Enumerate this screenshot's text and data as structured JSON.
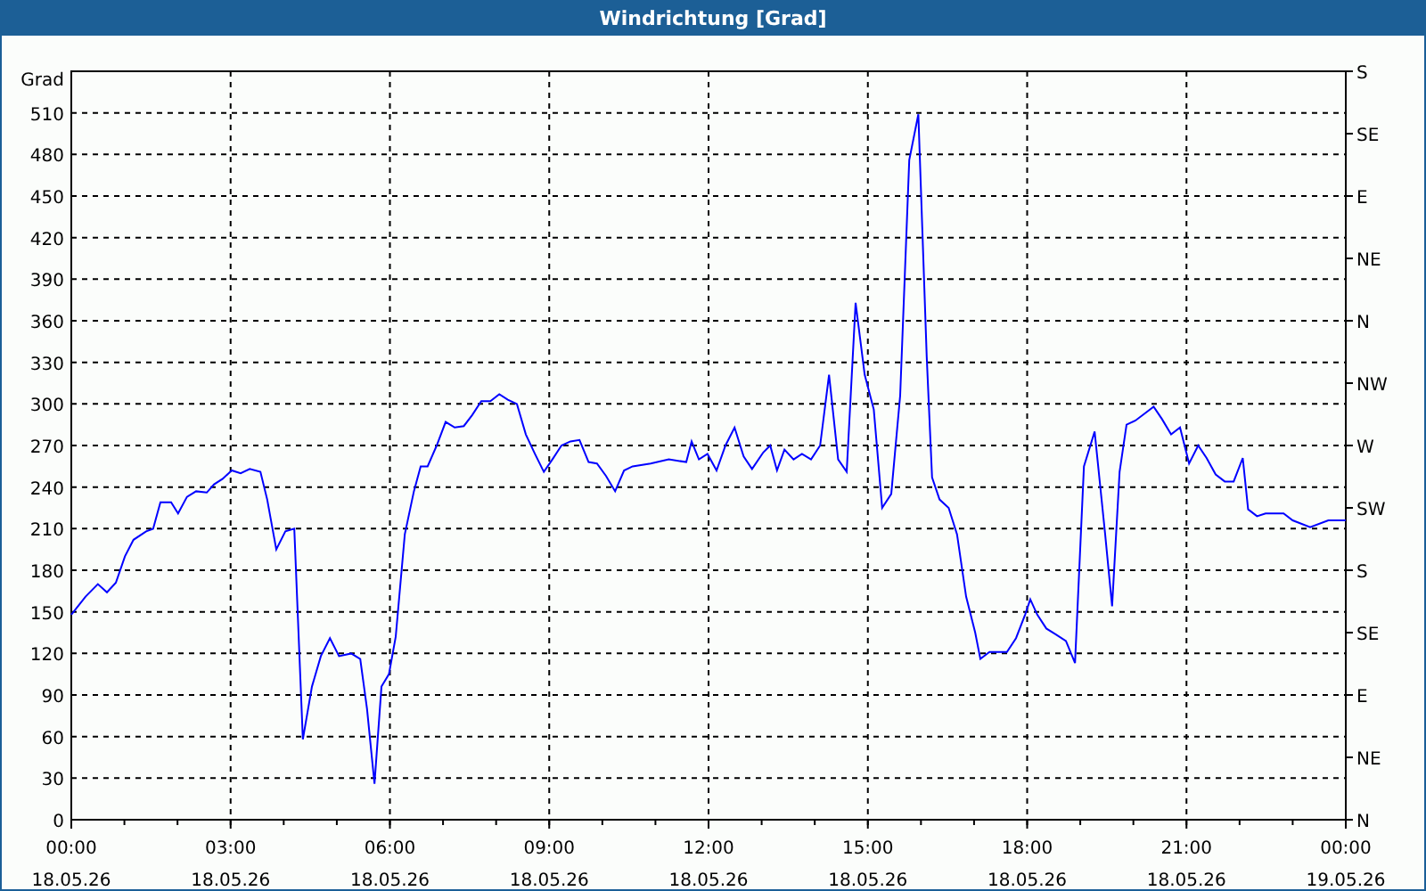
{
  "window": {
    "title": "Windrichtung [Grad]"
  },
  "chart": {
    "date_labels": [
      "18.05.26",
      "18.05.26",
      "18.05.26",
      "18.05.26",
      "18.05.26",
      "18.05.26",
      "18.05.26",
      "18.05.26",
      "19.05.26"
    ],
    "direction_labels": [
      "S",
      "SE",
      "E",
      "NE",
      "N",
      "NW",
      "W",
      "SW",
      "S",
      "SE",
      "E",
      "NE",
      "N"
    ],
    "chart_data": {
      "type": "line",
      "grid": true,
      "ylabel": "Grad",
      "ylim": [
        0,
        540
      ],
      "yticks": [
        0,
        30,
        60,
        90,
        120,
        150,
        180,
        210,
        240,
        270,
        300,
        330,
        360,
        390,
        420,
        450,
        480,
        510
      ],
      "xlim": [
        0,
        24
      ],
      "xticks": [
        {
          "value": 0,
          "label": "00:00"
        },
        {
          "value": 3,
          "label": "03:00"
        },
        {
          "value": 6,
          "label": "06:00"
        },
        {
          "value": 9,
          "label": "09:00"
        },
        {
          "value": 12,
          "label": "12:00"
        },
        {
          "value": 15,
          "label": "15:00"
        },
        {
          "value": 18,
          "label": "18:00"
        },
        {
          "value": 21,
          "label": "21:00"
        },
        {
          "value": 24,
          "label": "00:00"
        }
      ],
      "x": [
        0,
        0.27,
        0.5,
        0.67,
        0.84,
        1.01,
        1.17,
        1.41,
        1.54,
        1.68,
        1.88,
        2.01,
        2.18,
        2.35,
        2.55,
        2.69,
        2.85,
        3.02,
        3.19,
        3.36,
        3.56,
        3.69,
        3.86,
        4.03,
        4.2,
        4.36,
        4.53,
        4.7,
        4.87,
        5.04,
        5.27,
        5.44,
        5.57,
        5.71,
        5.84,
        5.98,
        6.11,
        6.28,
        6.45,
        6.58,
        6.71,
        6.88,
        7.05,
        7.22,
        7.39,
        7.55,
        7.72,
        7.89,
        8.06,
        8.22,
        8.39,
        8.56,
        8.73,
        8.9,
        9.06,
        9.23,
        9.4,
        9.57,
        9.74,
        9.9,
        10.07,
        10.24,
        10.41,
        10.57,
        10.91,
        11.25,
        11.58,
        11.68,
        11.82,
        11.98,
        12.15,
        12.32,
        12.49,
        12.66,
        12.82,
        13.03,
        13.16,
        13.29,
        13.43,
        13.6,
        13.76,
        13.93,
        14.1,
        14.27,
        14.44,
        14.6,
        14.77,
        14.94,
        15.11,
        15.27,
        15.44,
        15.61,
        15.78,
        15.95,
        16.11,
        16.21,
        16.35,
        16.52,
        16.68,
        16.85,
        17.02,
        17.12,
        17.29,
        17.46,
        17.62,
        17.79,
        17.96,
        18.06,
        18.19,
        18.36,
        18.53,
        18.73,
        18.9,
        19.07,
        19.27,
        19.47,
        19.6,
        19.74,
        19.87,
        20.04,
        20.21,
        20.38,
        20.54,
        20.71,
        20.88,
        21.05,
        21.22,
        21.38,
        21.55,
        21.72,
        21.89,
        22.06,
        22.16,
        22.33,
        22.49,
        22.83,
        23,
        23.33,
        23.67,
        24
      ],
      "series": [
        {
          "color": "#0000ff",
          "values": [
            148,
            161,
            170,
            164,
            171,
            190,
            202,
            208,
            210,
            229,
            229,
            221,
            233,
            237,
            236,
            242,
            246,
            252,
            250,
            253,
            251,
            231,
            195,
            208,
            210,
            58,
            96,
            118,
            131,
            118,
            120,
            116,
            80,
            26,
            96,
            105,
            132,
            206,
            237,
            255,
            255,
            270,
            287,
            283,
            284,
            292,
            302,
            302,
            307,
            303,
            300,
            278,
            264,
            251,
            260,
            270,
            273,
            274,
            258,
            257,
            248,
            237,
            252,
            255,
            257,
            260,
            258,
            273,
            260,
            264,
            252,
            270,
            283,
            262,
            253,
            265,
            270,
            252,
            267,
            260,
            264,
            260,
            270,
            321,
            260,
            251,
            373,
            321,
            296,
            225,
            235,
            306,
            476,
            509,
            334,
            247,
            231,
            225,
            206,
            161,
            135,
            116,
            121,
            121,
            121,
            131,
            148,
            159,
            148,
            138,
            134,
            129,
            113,
            255,
            280,
            206,
            154,
            251,
            285,
            288,
            293,
            298,
            289,
            278,
            283,
            257,
            270,
            261,
            249,
            244,
            244,
            261,
            224,
            219,
            221,
            221,
            216,
            211,
            216,
            216
          ]
        }
      ]
    }
  }
}
